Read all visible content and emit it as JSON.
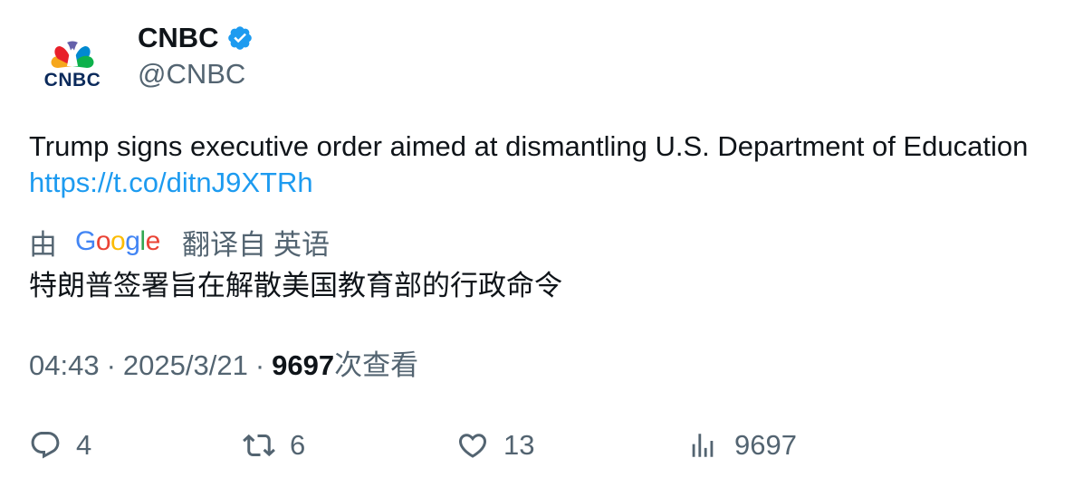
{
  "account": {
    "display_name": "CNBC",
    "handle": "@CNBC",
    "verified_icon": "verified-badge-icon",
    "avatar_logo_text": "CNBC",
    "brand_colors": [
      "#f6a71c",
      "#e8202a",
      "#6460aa",
      "#0089d0",
      "#0db14b",
      "#fcb711"
    ]
  },
  "tweet": {
    "text": "Trump signs executive order aimed at dismantling U.S. Department of Education ",
    "link": "https://t.co/ditnJ9XTRh"
  },
  "translation": {
    "prefix": "由",
    "provider": "Google",
    "suffix": "翻译自",
    "language": "英语",
    "text": "特朗普签署旨在解散美国教育部的行政命令"
  },
  "meta": {
    "time": "04:43",
    "date": "2025/3/21",
    "views_count": "9697",
    "views_label": "次查看",
    "separator": "·"
  },
  "actions": {
    "reply_count": "4",
    "retweet_count": "6",
    "like_count": "13",
    "views_count": "9697"
  },
  "colors": {
    "link": "#1d9bf0",
    "secondary_text": "#536471",
    "primary_text": "#0f1419",
    "verified": "#1d9bf0"
  }
}
